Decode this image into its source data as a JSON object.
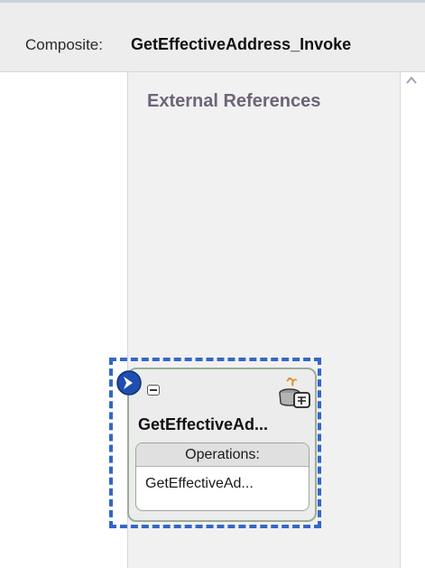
{
  "header": {
    "label": "Composite:",
    "value": "GetEffectiveAddress_Invoke"
  },
  "panel": {
    "title": "External References"
  },
  "reference": {
    "name": "GetEffectiveAd...",
    "operations_header": "Operations:",
    "operations": [
      "GetEffectiveAd..."
    ]
  },
  "icons": {
    "service": "chevron-right-circle-icon",
    "collapse": "minus-box-icon",
    "reference": "java-cup-reference-icon",
    "scroll": "chevron-up-icon"
  },
  "colors": {
    "selection": "#3367c8",
    "panel_background": "#f1f1f1",
    "panel_title": "#6e6478",
    "card_border": "#9bad98",
    "service_icon": "#1f4fae"
  }
}
